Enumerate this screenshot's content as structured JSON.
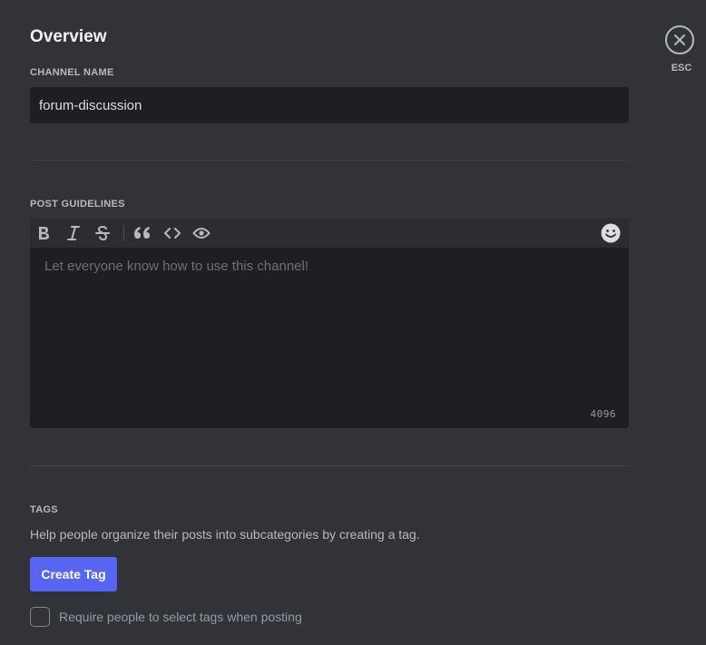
{
  "page": {
    "title": "Overview"
  },
  "channel_name": {
    "label": "CHANNEL NAME",
    "value": "forum-discussion"
  },
  "post_guidelines": {
    "label": "POST GUIDELINES",
    "placeholder": "Let everyone know how to use this channel!",
    "char_count": "4096",
    "toolbar": [
      "bold-icon",
      "italic-icon",
      "strikethrough-icon",
      "quote-icon",
      "code-icon",
      "spoiler-eye-icon",
      "emoji-icon"
    ]
  },
  "tags": {
    "label": "TAGS",
    "description": "Help people organize their posts into subcategories by creating a tag.",
    "create_button": "Create Tag",
    "require_checkbox_label": "Require people to select tags when posting"
  },
  "close": {
    "label": "ESC"
  },
  "colors": {
    "background": "#313338",
    "input_bg": "#1e1f22",
    "toolbar_bg": "#2b2d31",
    "accent": "#5865f2"
  }
}
